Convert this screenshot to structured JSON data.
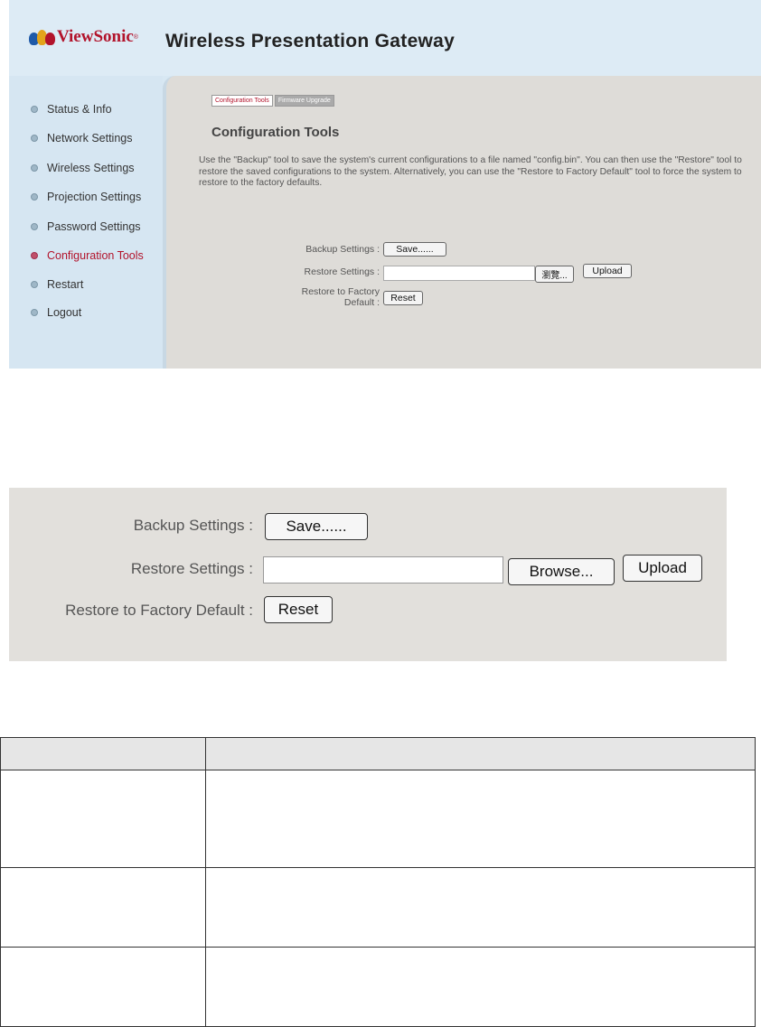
{
  "app": {
    "brand": "ViewSonic",
    "title": "Wireless Presentation Gateway"
  },
  "sidebar": {
    "items": [
      {
        "label": "Status & Info"
      },
      {
        "label": "Network Settings"
      },
      {
        "label": "Wireless Settings"
      },
      {
        "label": "Projection Settings"
      },
      {
        "label": "Password Settings"
      },
      {
        "label": "Configuration Tools"
      },
      {
        "label": "Restart"
      },
      {
        "label": "Logout"
      }
    ],
    "active": "Configuration Tools"
  },
  "tabs": [
    {
      "label": "Configuration Tools"
    },
    {
      "label": "Firmware Upgrade"
    }
  ],
  "page": {
    "title": "Configuration Tools",
    "description": "Use the \"Backup\" tool to save the system's current configurations to a file named \"config.bin\". You can then use the \"Restore\" tool to restore the saved configurations to the system. Alternatively, you can use the \"Restore to Factory Default\" tool to force the system to restore to the factory defaults."
  },
  "form_small": {
    "backup_label": "Backup Settings :",
    "backup_button": "Save......",
    "restore_label": "Restore Settings :",
    "browse_button": "瀏覽...",
    "upload_button": "Upload",
    "factory_label_line1": "Restore to Factory",
    "factory_label_line2": "Default :",
    "reset_button": "Reset"
  },
  "form_large": {
    "backup_label": "Backup Settings :",
    "backup_button": "Save......",
    "restore_label": "Restore Settings :",
    "browse_button": "Browse...",
    "upload_button": "Upload",
    "factory_label": "Restore to Factory Default :",
    "reset_button": "Reset"
  },
  "colors": {
    "brand_red": "#b2132b",
    "header_bg": "#ddebf5",
    "content_bg": "#dedcd8"
  }
}
